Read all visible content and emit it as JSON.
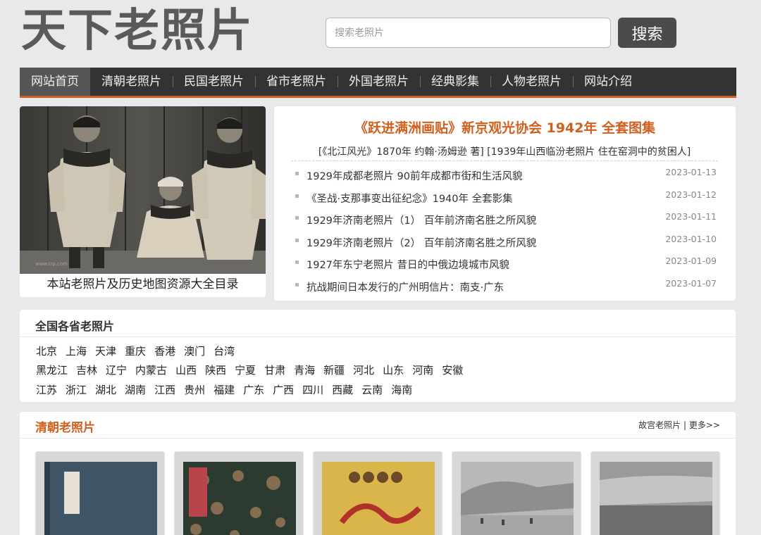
{
  "site": {
    "logo": "天下老照片"
  },
  "search": {
    "placeholder": "搜索老照片",
    "button_label": "搜索"
  },
  "nav": {
    "items": [
      "网站首页",
      "清朝老照片",
      "民国老照片",
      "省市老照片",
      "外国老照片",
      "经典影集",
      "人物老照片",
      "网站介绍"
    ],
    "active_index": 0
  },
  "featured": {
    "caption": "本站老照片及历史地图资源大全目录",
    "watermark": "www.lzp.com"
  },
  "news": {
    "headline": "《跃进满洲画贴》新京观光协会 1942年 全套图集",
    "subline": "[《北江风光》1870年 约翰·汤姆逊 著] [1939年山西临汾老照片 住在窑洞中的贫困人]",
    "items": [
      {
        "title": "1929年成都老照片 90前年成都市街和生活风貌",
        "date": "2023-01-13"
      },
      {
        "title": "《圣战·支那事变出征纪念》1940年 全套影集",
        "date": "2023-01-12"
      },
      {
        "title": "1929年济南老照片（1） 百年前济南名胜之所风貌",
        "date": "2023-01-11"
      },
      {
        "title": "1929年济南老照片（2） 百年前济南名胜之所风貌",
        "date": "2023-01-10"
      },
      {
        "title": "1927年东宁老照片 昔日的中俄边境城市风貌",
        "date": "2023-01-09"
      },
      {
        "title": "抗战期间日本发行的广州明信片：南支·广东",
        "date": "2023-01-07"
      }
    ]
  },
  "provinces": {
    "title": "全国各省老照片",
    "rows": [
      [
        "北京",
        "上海",
        "天津",
        "重庆",
        "香港",
        "澳门",
        "台湾"
      ],
      [
        "黑龙江",
        "吉林",
        "辽宁",
        "内蒙古",
        "山西",
        "陕西",
        "宁夏",
        "甘肃",
        "青海",
        "新疆",
        "河北",
        "山东",
        "河南",
        "安徽"
      ],
      [
        "江苏",
        "浙江",
        "湖北",
        "湖南",
        "江西",
        "贵州",
        "福建",
        "广东",
        "广西",
        "四川",
        "西藏",
        "云南",
        "海南"
      ]
    ]
  },
  "qing": {
    "title": "清朝老照片",
    "link_gugong": "故宫老照片",
    "separator": "|",
    "link_more": "更多>>"
  },
  "colors": {
    "accent": "#d0601f",
    "nav_bg": "#333333",
    "logo": "#5a5a5a"
  }
}
